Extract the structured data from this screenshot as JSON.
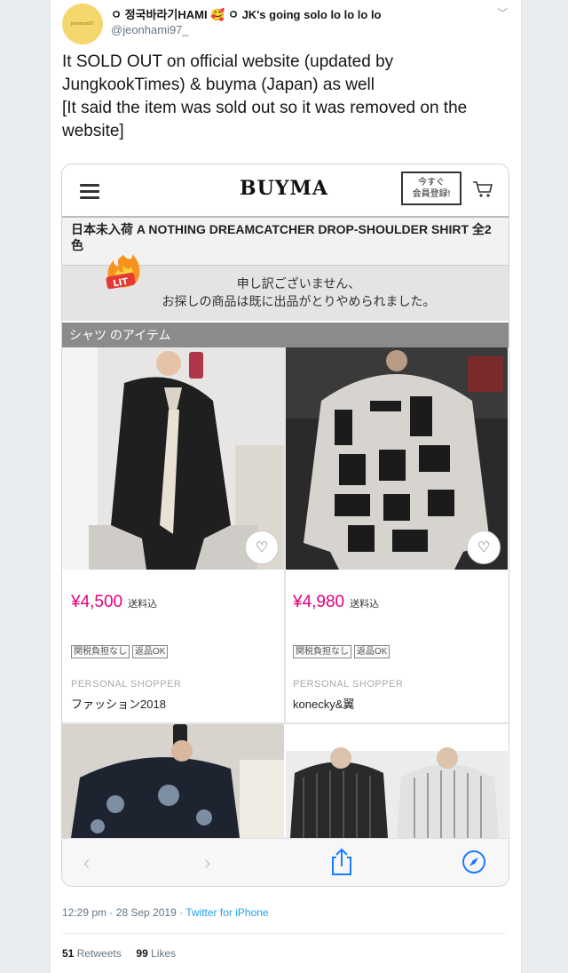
{
  "tweet": {
    "avatar_text": "jeonhami97",
    "display_name": "ㅇ 정국바라기HAMI 🥰 ㅇ JK's going solo lo lo lo lo",
    "handle": "@jeonhami97_",
    "text_line1": "It SOLD OUT on official website (updated by JungkookTimes) & buyma (Japan) as well",
    "text_line2": "[It said the item was sold out so it was removed on the website]",
    "timestamp": "12:29 pm · 28 Sep 2019 · ",
    "source": "Twitter for iPhone",
    "retweets_count": "51",
    "retweets_label": "Retweets",
    "likes_count": "99",
    "likes_label": "Likes"
  },
  "buyma": {
    "logo": "BUYMA",
    "register_line1": "今すぐ",
    "register_line2": "会員登録!",
    "product_title": "日本未入荷 A NOTHING DREAMCATCHER DROP-SHOULDER SHIRT 全2色",
    "lit_label": "LIT",
    "notice_line1": "申し訳ございません、",
    "notice_line2": "お探しの商品は既に出品がとりやめられました。",
    "section_title": "シャツ のアイテム",
    "items": [
      {
        "price": "¥4,500",
        "shipping": "送料込",
        "tag1": "関税負担なし",
        "tag2": "返品OK",
        "label": "PERSONAL SHOPPER",
        "shop": "ファッション2018"
      },
      {
        "price": "¥4,980",
        "shipping": "送料込",
        "tag1": "関税負担なし",
        "tag2": "返品OK",
        "label": "PERSONAL SHOPPER",
        "shop": "konecky&翼"
      }
    ]
  },
  "colors": {
    "price": "#e4007f",
    "link": "#1da1f2",
    "section_bar": "#8b8b8b"
  }
}
